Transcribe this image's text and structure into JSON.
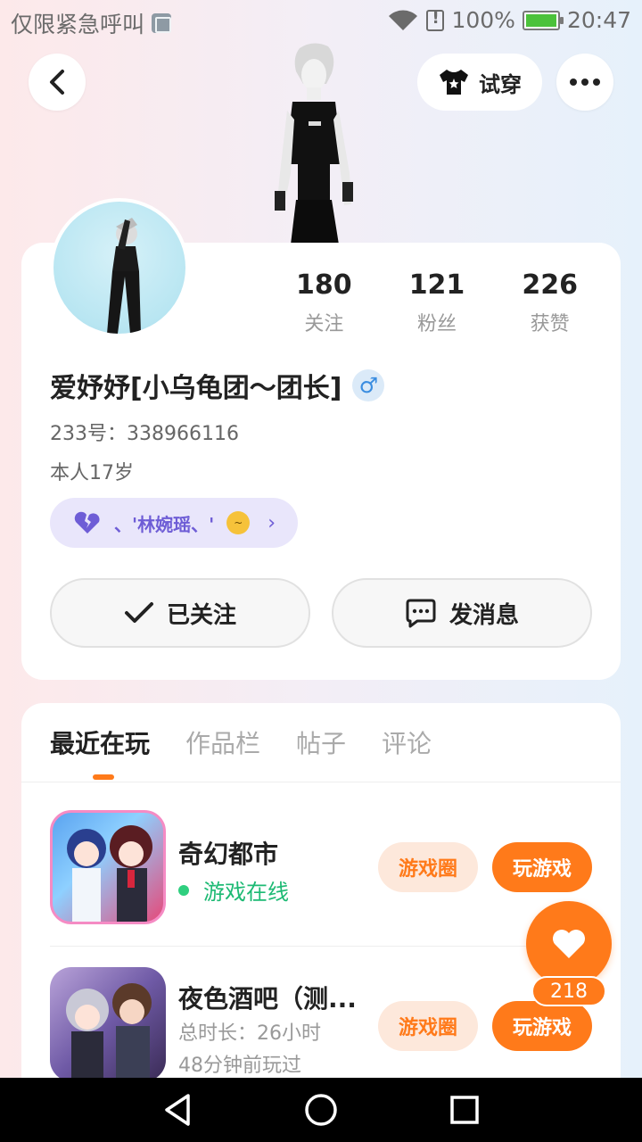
{
  "status_bar": {
    "carrier": "仅限紧急呼叫",
    "battery": "100%",
    "time": "20:47"
  },
  "header": {
    "tryon_label": "试穿"
  },
  "profile": {
    "stats": [
      {
        "value": "180",
        "label": "关注"
      },
      {
        "value": "121",
        "label": "粉丝"
      },
      {
        "value": "226",
        "label": "获赞"
      }
    ],
    "username": "爱妤妤[小乌龟团～团长]",
    "gender": "♂",
    "uid": "233号：338966116",
    "bio": "本人17岁",
    "cp_text": "、'林婉瑶、'",
    "follow_label": "已关注",
    "message_label": "发消息"
  },
  "tabs": [
    {
      "label": "最近在玩",
      "active": true
    },
    {
      "label": "作品栏",
      "active": false
    },
    {
      "label": "帖子",
      "active": false
    },
    {
      "label": "评论",
      "active": false
    }
  ],
  "games": [
    {
      "name": "奇幻都市",
      "status": "游戏在线",
      "circle_label": "游戏圈",
      "play_label": "玩游戏"
    },
    {
      "name": "夜色酒吧（测...",
      "duration": "总时长：26小时",
      "last_played": "48分钟前玩过",
      "circle_label": "游戏圈",
      "play_label": "玩游戏"
    }
  ],
  "floating_like": {
    "count": "218"
  },
  "colors": {
    "accent": "#ff7a1a",
    "online": "#1dba74",
    "cp_purple": "#6e5dd6"
  }
}
